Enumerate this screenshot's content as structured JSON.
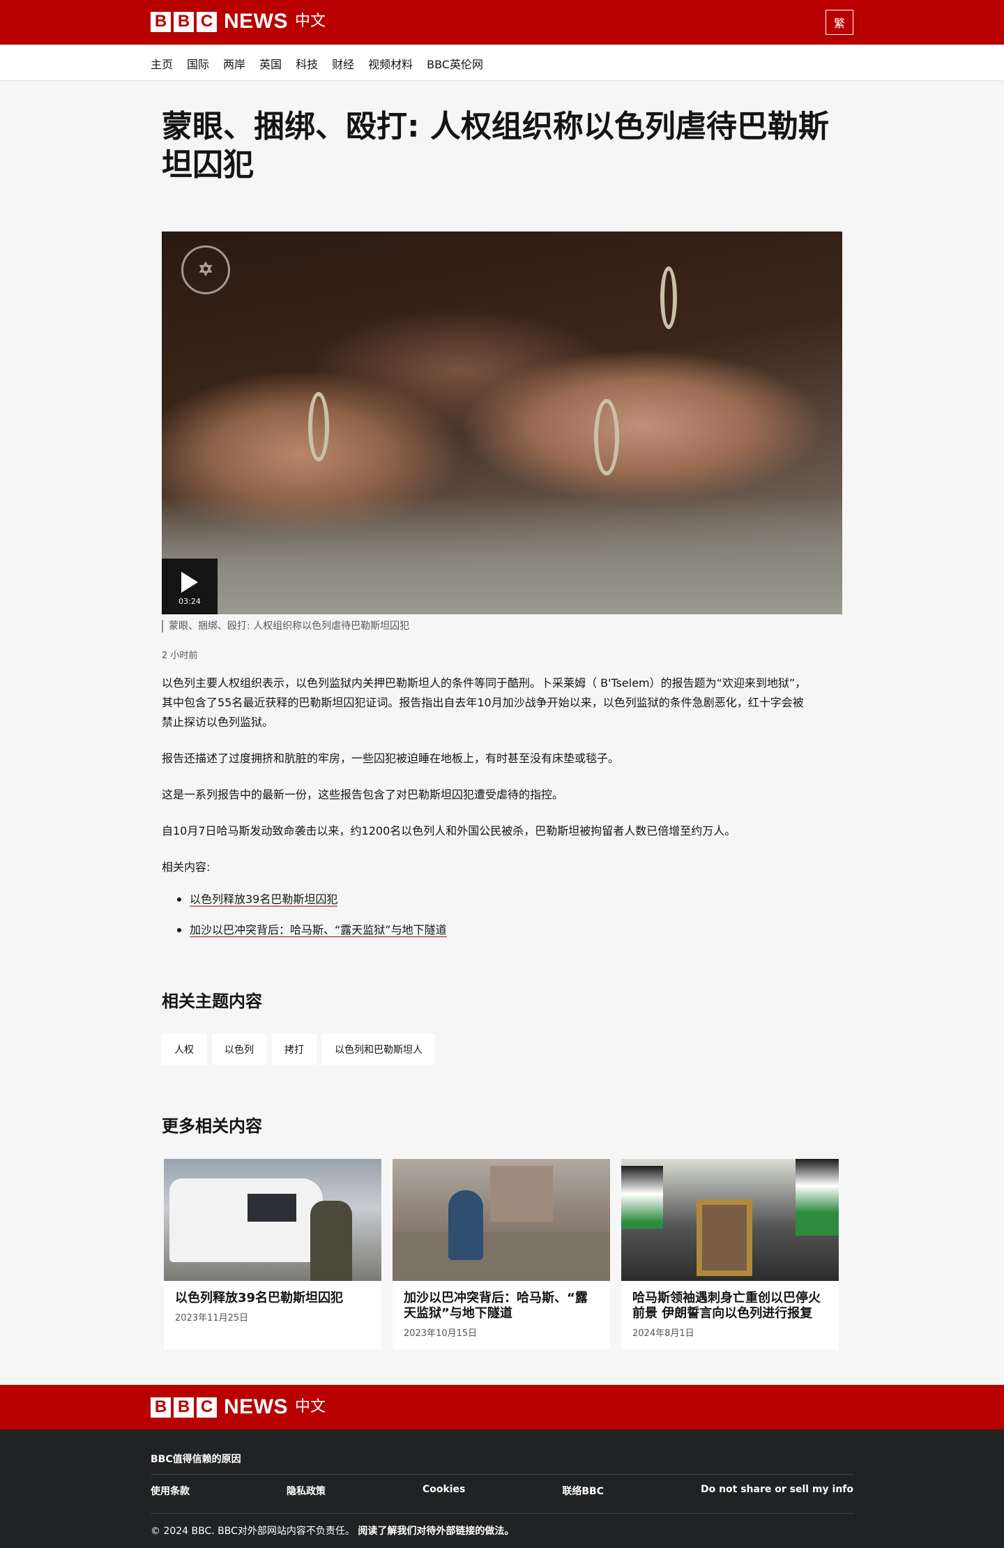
{
  "header": {
    "logo_letters": [
      "B",
      "B",
      "C"
    ],
    "logo_news": "NEWS",
    "logo_lang": "中文",
    "lang_switch": "繁",
    "brand_color": "#b80000"
  },
  "nav": {
    "items": [
      "主页",
      "国际",
      "两岸",
      "英国",
      "科技",
      "财经",
      "视频材料",
      "BBC英伦网"
    ]
  },
  "article": {
    "headline": "蒙眼、捆绑、殴打: 人权组织称以色列虐待巴勒斯坦囚犯",
    "video": {
      "duration": "03:24",
      "caption": "蒙眼、捆绑、殴打: 人权组织称以色列虐待巴勒斯坦囚犯",
      "play_icon": "play-icon"
    },
    "timestamp": "2 小时前",
    "paragraphs": [
      "以色列主要人权组织表示，以色列监狱内关押巴勒斯坦人的条件等同于酷刑。卜采莱姆（ B'Tselem）的报告题为“欢迎来到地狱”，其中包含了55名最近获释的巴勒斯坦囚犯证词。报告指出自去年10月加沙战争开始以来，以色列监狱的条件急剧恶化，红十字会被禁止探访以色列监狱。",
      "报告还描述了过度拥挤和肮脏的牢房，一些囚犯被迫睡在地板上，有时甚至没有床垫或毯子。",
      "这是一系列报告中的最新一份，这些报告包含了对巴勒斯坦囚犯遭受虐待的指控。",
      "自10月7日哈马斯发动致命袭击以来，约1200名以色列人和外国公民被杀，巴勒斯坦被拘留者人数已倍增至约万人。",
      "相关内容:"
    ],
    "related_links": [
      "以色列释放39名巴勒斯坦囚犯",
      "加沙以巴冲突背后：哈马斯、“露天监狱”与地下隧道"
    ]
  },
  "topics": {
    "title": "相关主题内容",
    "tags": [
      "人权",
      "以色列",
      "拷打",
      "以色列和巴勒斯坦人"
    ]
  },
  "more": {
    "title": "更多相关内容",
    "cards": [
      {
        "title": "以色列释放39名巴勒斯坦囚犯",
        "date": "2023年11月25日"
      },
      {
        "title": "加沙以巴冲突背后：哈马斯、“露天监狱”与地下隧道",
        "date": "2023年10月15日"
      },
      {
        "title": "哈马斯领袖遇刺身亡重创以巴停火前景 伊朗誓言向以色列进行报复",
        "date": "2024年8月1日"
      }
    ]
  },
  "footer": {
    "why": "BBC值得信赖的原因",
    "links": [
      "使用条款",
      "隐私政策",
      "Cookies",
      "联络BBC",
      "Do not share or sell my info"
    ],
    "copyright": "© 2024 BBC. BBC对外部网站内容不负责任。",
    "external_link": "阅读了解我们对待外部链接的做法。"
  }
}
